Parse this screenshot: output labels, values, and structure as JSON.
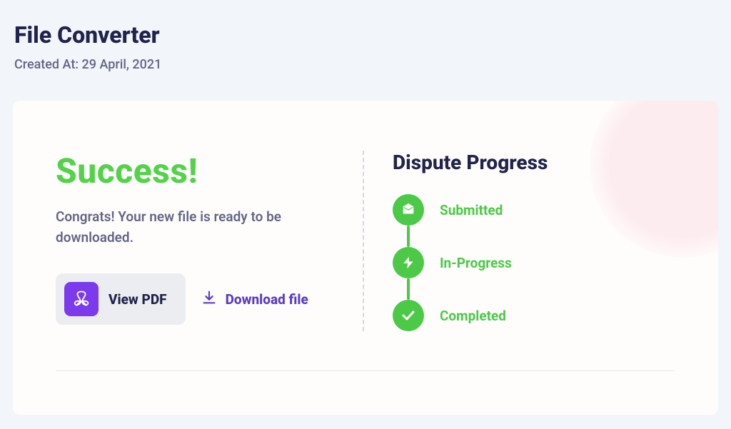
{
  "header": {
    "title": "File Converter",
    "subtitle_prefix": "Created At: ",
    "created_at": "29 April, 2021"
  },
  "success": {
    "heading": "Success!",
    "message": "Congrats! Your new file is ready to be downloaded.",
    "view_pdf_label": "View PDF",
    "download_label": "Download file"
  },
  "progress": {
    "title": "Dispute Progress",
    "steps": [
      {
        "label": "Submitted",
        "icon": "envelope-icon"
      },
      {
        "label": "In-Progress",
        "icon": "bolt-icon"
      },
      {
        "label": "Completed",
        "icon": "check-icon"
      }
    ]
  },
  "colors": {
    "success_green": "#4bc947",
    "heading_green": "#55d24b",
    "purple": "#7c3aed",
    "link_purple": "#5b3cc4",
    "dark_navy": "#20234a",
    "muted_text": "#626684"
  }
}
